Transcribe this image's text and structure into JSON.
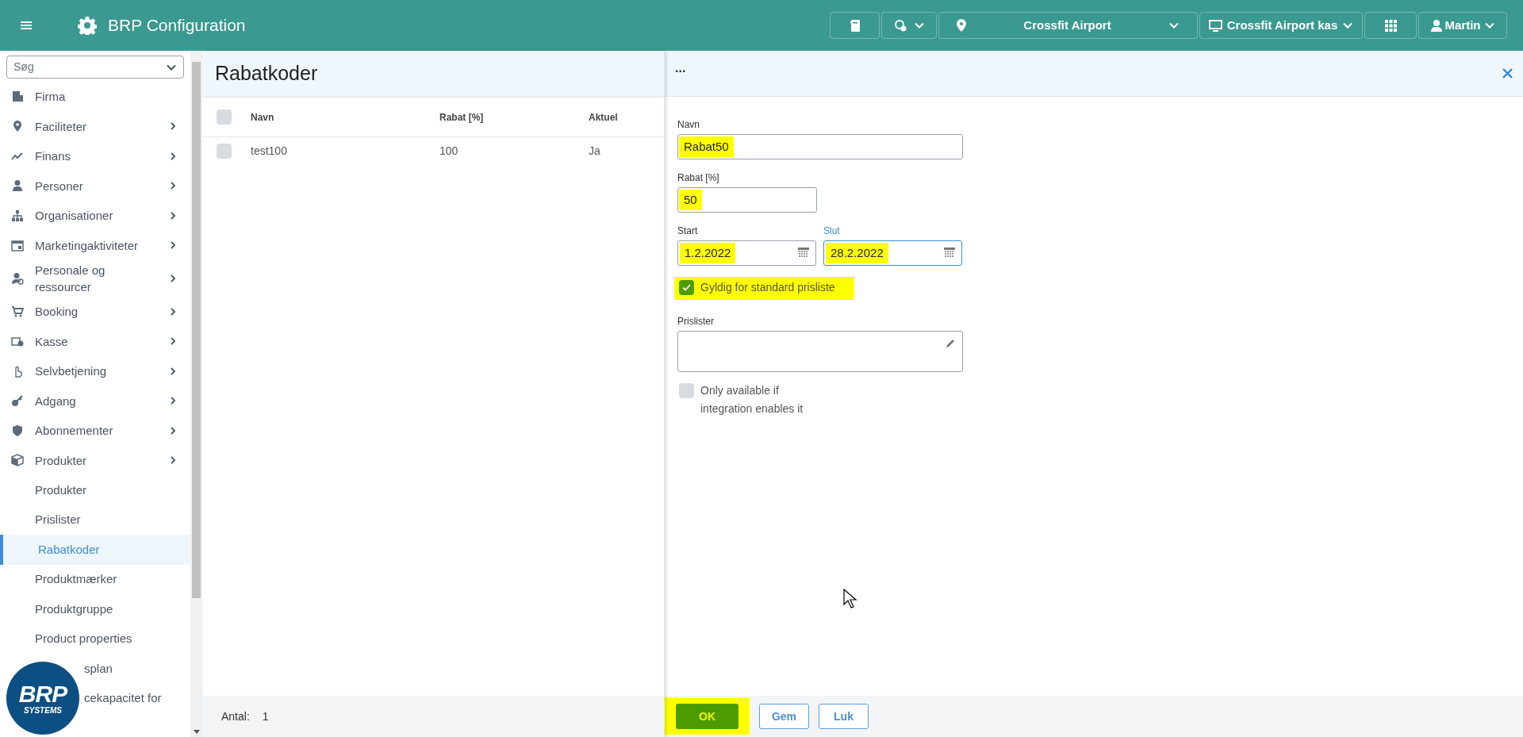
{
  "app": {
    "title": "BRP Configuration"
  },
  "logo": {
    "text": "BRP",
    "subtext": "SYSTEMS"
  },
  "toolbar": {
    "location": "Crossfit Airport",
    "register": "Crossfit Airport kas",
    "user": "Martin"
  },
  "sidebar": {
    "search": {
      "placeholder": "Søg"
    },
    "items": [
      {
        "label": "Firma",
        "has_submenu": false
      },
      {
        "label": "Faciliteter",
        "has_submenu": true
      },
      {
        "label": "Finans",
        "has_submenu": true
      },
      {
        "label": "Personer",
        "has_submenu": true
      },
      {
        "label": "Organisationer",
        "has_submenu": true
      },
      {
        "label": "Marketingaktiviteter",
        "has_submenu": true
      },
      {
        "label": "Personale og ressourcer",
        "has_submenu": true
      },
      {
        "label": "Booking",
        "has_submenu": true
      },
      {
        "label": "Kasse",
        "has_submenu": true
      },
      {
        "label": "Selvbetjening",
        "has_submenu": true
      },
      {
        "label": "Adgang",
        "has_submenu": true
      },
      {
        "label": "Abonnementer",
        "has_submenu": true
      },
      {
        "label": "Produkter",
        "has_submenu": true,
        "children": [
          {
            "label": "Produkter",
            "selected": false
          },
          {
            "label": "Prislister",
            "selected": false
          },
          {
            "label": "Rabatkoder",
            "selected": true
          },
          {
            "label": "Produktmærker",
            "selected": false
          },
          {
            "label": "Produktgruppe",
            "selected": false
          },
          {
            "label": "Product properties",
            "selected": false
          },
          {
            "label": "splan",
            "selected": false
          },
          {
            "label": "cekapacitet for",
            "selected": false
          }
        ]
      }
    ]
  },
  "main": {
    "title": "Rabatkoder",
    "table": {
      "select_all": {
        "checked": false
      },
      "columns": [
        "Navn",
        "Rabat [%]",
        "Aktuel"
      ],
      "rows": [
        {
          "checked": false,
          "cells": [
            "test100",
            "100",
            "Ja"
          ]
        }
      ]
    },
    "footer": {
      "count_label": "Antal:",
      "count": "1"
    }
  },
  "panel": {
    "title": "...",
    "fields": [
      {
        "kind": "text",
        "label": "Navn",
        "value": "Rabat50",
        "highlighted": true
      },
      {
        "kind": "number",
        "label": "Rabat [%]",
        "value": "50",
        "highlighted": true
      },
      {
        "kind": "dates",
        "items": [
          {
            "label": "Start",
            "value": "1.2.2022",
            "focused": false,
            "highlighted": true
          },
          {
            "label": "Slut",
            "value": "28.2.2022",
            "focused": true,
            "highlighted": true
          }
        ]
      },
      {
        "kind": "checkbox",
        "label": "Gyldig for standard prisliste",
        "checked": true,
        "highlighted": true
      },
      {
        "kind": "textarea",
        "label": "Prislister"
      },
      {
        "kind": "checkbox",
        "label": "Only available if integration enables it",
        "checked": false,
        "highlighted": false
      }
    ],
    "buttons": [
      {
        "label": "OK",
        "primary": true,
        "highlighted": true
      },
      {
        "label": "Gem",
        "primary": false,
        "highlighted": false
      },
      {
        "label": "Luk",
        "primary": false,
        "highlighted": false
      }
    ]
  }
}
